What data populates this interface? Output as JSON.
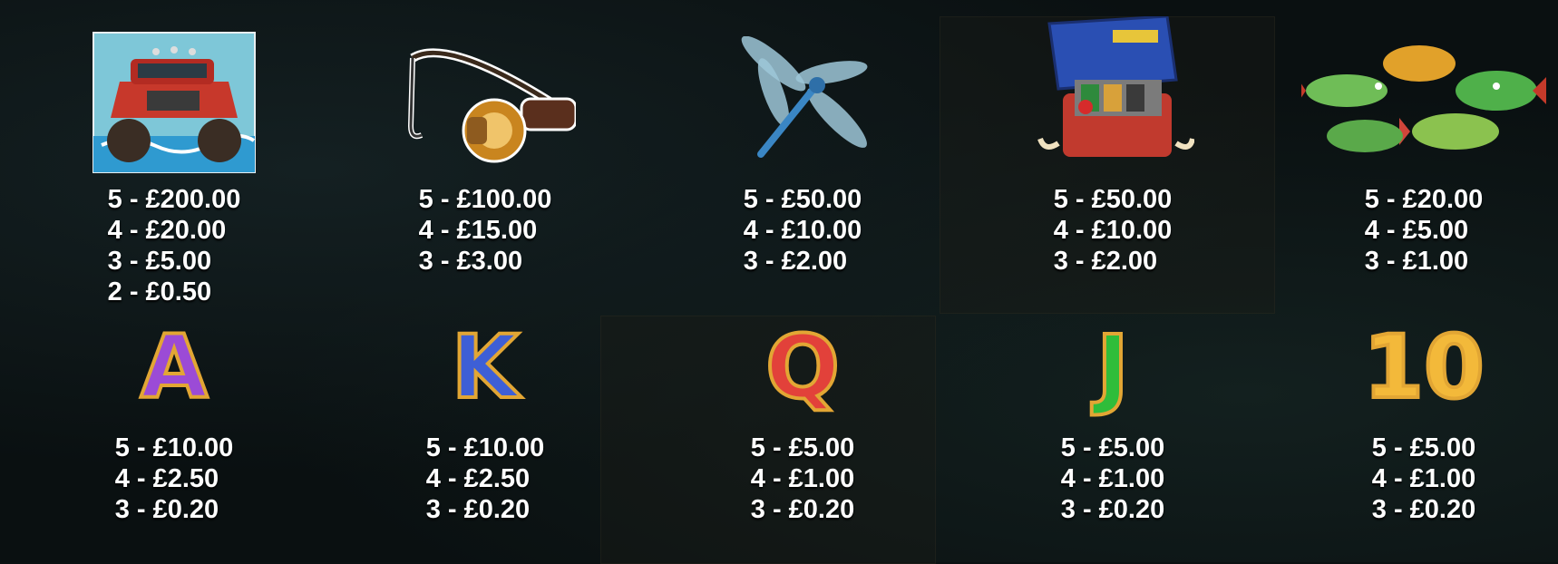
{
  "paytable": {
    "high_symbols": [
      {
        "icon": "monster-truck-icon",
        "payouts": [
          "5 - £200.00",
          "4 - £20.00",
          "3 - £5.00",
          "2 - £0.50"
        ]
      },
      {
        "icon": "fishing-rod-icon",
        "payouts": [
          "5 - £100.00",
          "4 - £15.00",
          "3 - £3.00"
        ]
      },
      {
        "icon": "dragonfly-icon",
        "payouts": [
          "5 - £50.00",
          "4 - £10.00",
          "3 - £2.00"
        ]
      },
      {
        "icon": "tackle-box-icon",
        "payouts": [
          "5 - £50.00",
          "4 - £10.00",
          "3 - £2.00"
        ]
      },
      {
        "icon": "fish-group-icon",
        "payouts": [
          "5 - £20.00",
          "4 - £5.00",
          "3 - £1.00"
        ]
      }
    ],
    "low_symbols": [
      {
        "label": "A",
        "color": "#9b4bd6",
        "payouts": [
          "5 - £10.00",
          "4 - £2.50",
          "3 - £0.20"
        ]
      },
      {
        "label": "K",
        "color": "#3e5fd6",
        "payouts": [
          "5 - £10.00",
          "4 - £2.50",
          "3 - £0.20"
        ]
      },
      {
        "label": "Q",
        "color": "#e2413a",
        "payouts": [
          "5 - £5.00",
          "4 - £1.00",
          "3 - £0.20"
        ]
      },
      {
        "label": "J",
        "color": "#2fbd3a",
        "payouts": [
          "5 - £5.00",
          "4 - £1.00",
          "3 - £0.20"
        ]
      },
      {
        "label": "10",
        "color": "#f3b93a",
        "payouts": [
          "5 - £5.00",
          "4 - £1.00",
          "3 - £0.20"
        ]
      }
    ]
  }
}
